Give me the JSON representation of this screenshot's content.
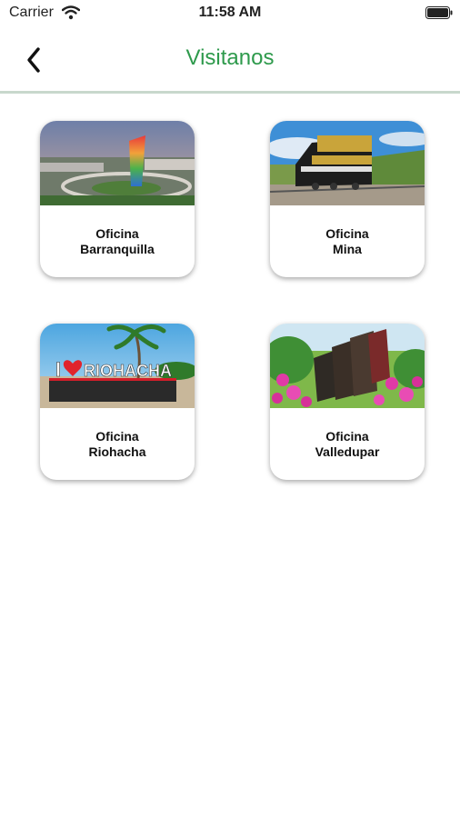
{
  "status_bar": {
    "carrier": "Carrier",
    "time": "11:58 AM"
  },
  "header": {
    "title": "Visitanos",
    "back_icon": "chevron-left-icon"
  },
  "colors": {
    "title": "#2e9a4c",
    "divider": "#c8d8cc"
  },
  "offices": [
    {
      "line1": "Oficina",
      "line2": "Barranquilla"
    },
    {
      "line1": "Oficina",
      "line2": "Mina"
    },
    {
      "line1": "Oficina",
      "line2": "Riohacha",
      "sign": "I",
      "sign_word": "RIOHACHA"
    },
    {
      "line1": "Oficina",
      "line2": "Valledupar"
    }
  ]
}
